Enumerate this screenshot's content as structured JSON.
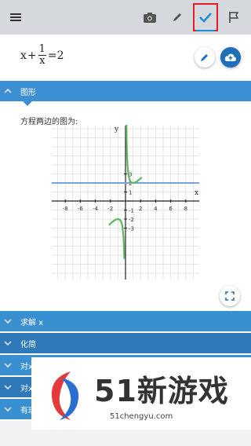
{
  "toolbar": {
    "icons": [
      "menu-icon",
      "camera-icon",
      "pencil-icon",
      "check-icon",
      "flag-icon"
    ],
    "active_tab": "check",
    "accent_color": "#1c8fd8",
    "highlight_color": "#e02020"
  },
  "equation": {
    "lhs_var": "x",
    "plus": "+",
    "frac_num": "1",
    "frac_den": "x",
    "rhs": "=2"
  },
  "sections": {
    "graph_label": "图形",
    "caption": "方程两边的图为:",
    "solve_label": "求解 x",
    "simplify_label": "化简",
    "item4_label": "对x",
    "item5_label": "对x",
    "item6_label": "有理"
  },
  "graph": {
    "x_axis_label": "x",
    "y_axis_label": "y",
    "x_ticks": [
      "-8",
      "-6",
      "-4",
      "-2",
      "2",
      "4",
      "6",
      "8"
    ],
    "y_ticks": [
      "3",
      "2",
      "1",
      "-1",
      "-2",
      "-3"
    ],
    "xlim": [
      -10,
      10
    ],
    "ylim": [
      -4,
      4
    ],
    "grid": true,
    "series": [
      {
        "color": "#79a3d4",
        "kind": "horizontal line y=2"
      },
      {
        "color": "#5bb85b",
        "kind": "curve x+1/x"
      }
    ]
  },
  "watermark": {
    "brand": "51新游戏",
    "url": "51chengyu.com"
  },
  "colors": {
    "header_blue": "#3a8fd0",
    "header_blue_dark": "#2f79b8",
    "toolbar_bg": "#d5d9de"
  }
}
